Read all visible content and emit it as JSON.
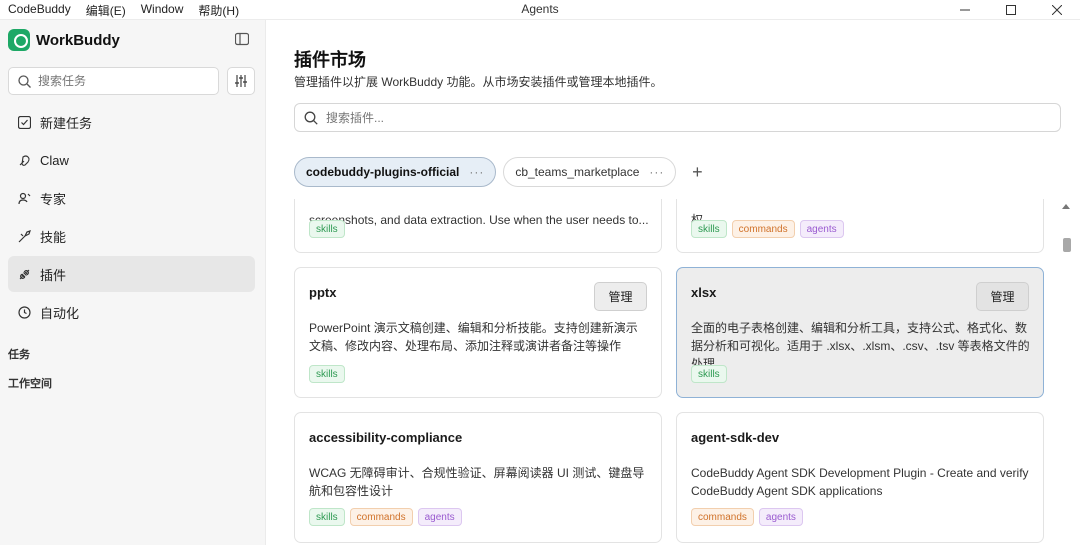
{
  "titlebar": {
    "menu": [
      "CodeBuddy",
      "编辑(E)",
      "Window",
      "帮助(H)"
    ],
    "title": "Agents"
  },
  "sidebar": {
    "brand": "WorkBuddy",
    "search_placeholder": "搜索任务",
    "nav": [
      {
        "label": "新建任务",
        "icon": "new-task-icon"
      },
      {
        "label": "Claw",
        "icon": "claw-icon"
      },
      {
        "label": "专家",
        "icon": "experts-icon"
      },
      {
        "label": "技能",
        "icon": "skills-icon"
      },
      {
        "label": "插件",
        "icon": "plugin-icon",
        "active": true
      },
      {
        "label": "自动化",
        "icon": "clock-icon"
      }
    ],
    "sections": [
      "任务",
      "工作空间"
    ]
  },
  "main": {
    "title": "插件市场",
    "subtitle": "管理插件以扩展 WorkBuddy 功能。从市场安装插件或管理本地插件。",
    "search_placeholder": "搜索插件...",
    "tabs": [
      {
        "label": "codebuddy-plugins-official",
        "active": true
      },
      {
        "label": "cb_teams_marketplace",
        "active": false
      }
    ],
    "manage_label": "管理",
    "cards": [
      {
        "name": "",
        "desc": "screenshots, and data extraction. Use when the user needs to...",
        "tags": [
          "skills"
        ]
      },
      {
        "name": "",
        "desc": "权",
        "tags": [
          "skills",
          "commands",
          "agents"
        ]
      },
      {
        "name": "pptx",
        "desc": "PowerPoint 演示文稿创建、编辑和分析技能。支持创建新演示文稿、修改内容、处理布局、添加注释或演讲者备注等操作",
        "tags": [
          "skills"
        ],
        "manage": true
      },
      {
        "name": "xlsx",
        "desc": "全面的电子表格创建、编辑和分析工具，支持公式、格式化、数据分析和可视化。适用于 .xlsx、.xlsm、.csv、.tsv 等表格文件的处理",
        "tags": [
          "skills"
        ],
        "manage": true,
        "selected": true
      },
      {
        "name": "accessibility-compliance",
        "desc": "WCAG 无障碍审计、合规性验证、屏幕阅读器 UI 测试、键盘导航和包容性设计",
        "tags": [
          "skills",
          "commands",
          "agents"
        ]
      },
      {
        "name": "agent-sdk-dev",
        "desc": "CodeBuddy Agent SDK Development Plugin - Create and verify CodeBuddy Agent SDK applications",
        "tags": [
          "commands",
          "agents"
        ]
      }
    ]
  }
}
